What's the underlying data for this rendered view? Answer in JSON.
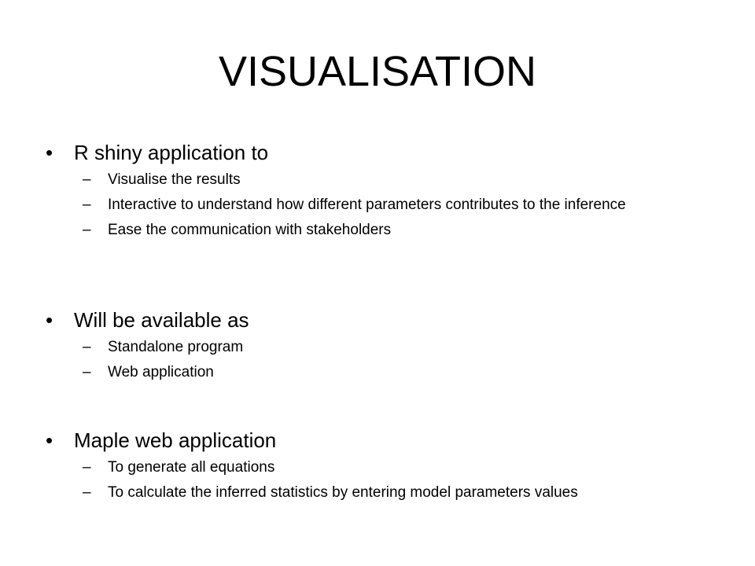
{
  "slide": {
    "title": "VISUALISATION",
    "bullets": [
      {
        "marker": "•",
        "text": "R shiny application to",
        "sub_marker": "–",
        "sub_items": [
          "Visualise the results",
          "Interactive to  understand how different parameters contributes to the inference",
          "Ease the communication with stakeholders"
        ]
      },
      {
        "marker": "•",
        "text": "Will be available as",
        "sub_marker": "–",
        "sub_items": [
          "Standalone program",
          "Web application"
        ]
      },
      {
        "marker": "•",
        "text": "Maple web application",
        "sub_marker": "–",
        "sub_items": [
          "To generate all equations",
          "To calculate the inferred statistics by entering model parameters values"
        ]
      }
    ]
  }
}
